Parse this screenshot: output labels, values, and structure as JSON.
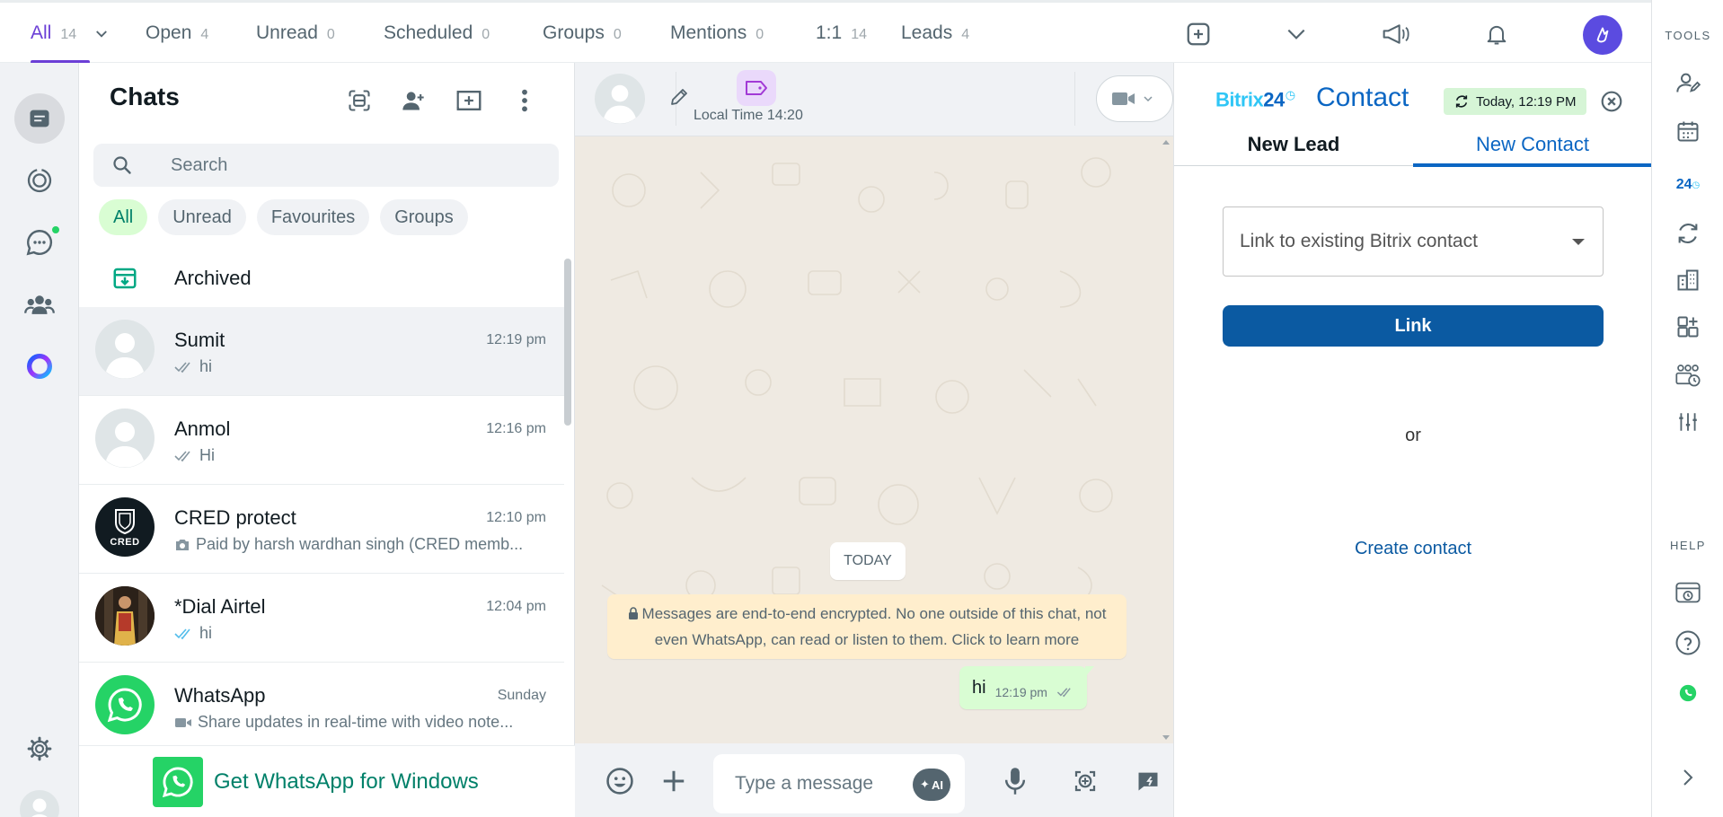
{
  "filter_tabs": [
    {
      "label": "All",
      "count": "14"
    },
    {
      "label": "Open",
      "count": "4"
    },
    {
      "label": "Unread",
      "count": "0"
    },
    {
      "label": "Scheduled",
      "count": "0"
    },
    {
      "label": "Groups",
      "count": "0"
    },
    {
      "label": "Mentions",
      "count": "0"
    },
    {
      "label": "1:1",
      "count": "14"
    },
    {
      "label": "Leads",
      "count": "4"
    }
  ],
  "top_icons": [
    "plus-square-icon",
    "chevron-down-icon",
    "megaphone-icon",
    "bell-icon",
    "user-avatar-icon"
  ],
  "rail_icons": [
    "chats-icon",
    "status-icon",
    "channels-icon",
    "communities-icon",
    "meta-ai-icon",
    "settings-icon",
    "profile-avatar-icon"
  ],
  "chatlist": {
    "title": "Chats",
    "search_placeholder": "Search",
    "chips": [
      "All",
      "Unread",
      "Favourites",
      "Groups"
    ],
    "archived_label": "Archived",
    "rows": [
      {
        "name": "Sumit",
        "time": "12:19 pm",
        "preview": "hi"
      },
      {
        "name": "Anmol",
        "time": "12:16 pm",
        "preview": "Hi"
      },
      {
        "name": "CRED protect",
        "time": "12:10 pm",
        "preview": "Paid by harsh wardhan singh (CRED memb...",
        "avatar_text": "CRED"
      },
      {
        "name": "*Dial Airtel",
        "time": "12:04 pm",
        "preview": "hi"
      },
      {
        "name": "WhatsApp",
        "time": "Sunday",
        "preview": "Share updates in real-time with video note..."
      }
    ],
    "get_app_label": "Get WhatsApp for Windows"
  },
  "conversation": {
    "local_time": "Local Time 14:20",
    "today_label": "TODAY",
    "e2e_notice": "Messages are end-to-end encrypted. No one outside of this chat, not even WhatsApp, can read or listen to them. Click to learn more",
    "message": {
      "text": "hi",
      "time": "12:19 pm"
    },
    "composer_placeholder": "Type a message",
    "ai_label": "AI"
  },
  "panel": {
    "brand": "Bitrix",
    "brand_num": "24",
    "title": "Contact",
    "date_badge": "Today, 12:19 PM",
    "tabs": [
      "New Lead",
      "New Contact"
    ],
    "select_label": "Link to existing Bitrix contact",
    "link_button": "Link",
    "or_label": "or",
    "create_link": "Create contact"
  },
  "tools": {
    "tools_heading": "TOOLS",
    "help_heading": "HELP",
    "badge_text": "24"
  },
  "colors": {
    "accent": "#6b3fd6",
    "wa_green": "#25d366",
    "bitrix_blue": "#0b66c3"
  }
}
